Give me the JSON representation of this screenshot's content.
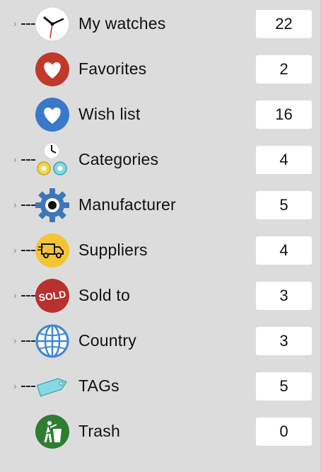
{
  "sidebar": {
    "items": [
      {
        "id": "my-watches",
        "label": "My watches",
        "count": "22",
        "icon": "clock-icon",
        "expandable": true
      },
      {
        "id": "favorites",
        "label": "Favorites",
        "count": "2",
        "icon": "heart-red-icon",
        "expandable": false
      },
      {
        "id": "wish-list",
        "label": "Wish list",
        "count": "16",
        "icon": "heart-blue-icon",
        "expandable": false
      },
      {
        "id": "categories",
        "label": "Categories",
        "count": "4",
        "icon": "categories-icon",
        "expandable": true
      },
      {
        "id": "manufacturer",
        "label": "Manufacturer",
        "count": "5",
        "icon": "gear-icon",
        "expandable": true
      },
      {
        "id": "suppliers",
        "label": "Suppliers",
        "count": "4",
        "icon": "truck-icon",
        "expandable": true
      },
      {
        "id": "sold-to",
        "label": "Sold to",
        "count": "3",
        "icon": "sold-icon",
        "expandable": true
      },
      {
        "id": "country",
        "label": "Country",
        "count": "3",
        "icon": "globe-icon",
        "expandable": true
      },
      {
        "id": "tags",
        "label": "TAGs",
        "count": "5",
        "icon": "tag-icon",
        "expandable": true
      },
      {
        "id": "trash",
        "label": "Trash",
        "count": "0",
        "icon": "trash-icon",
        "expandable": false
      }
    ],
    "icon_text": {
      "sold": "SOLD"
    },
    "colors": {
      "red": "#c0392b",
      "blue": "#3a78c9",
      "yellow": "#f4c433",
      "green": "#2e7d32",
      "cyan": "#86d8e6"
    }
  }
}
